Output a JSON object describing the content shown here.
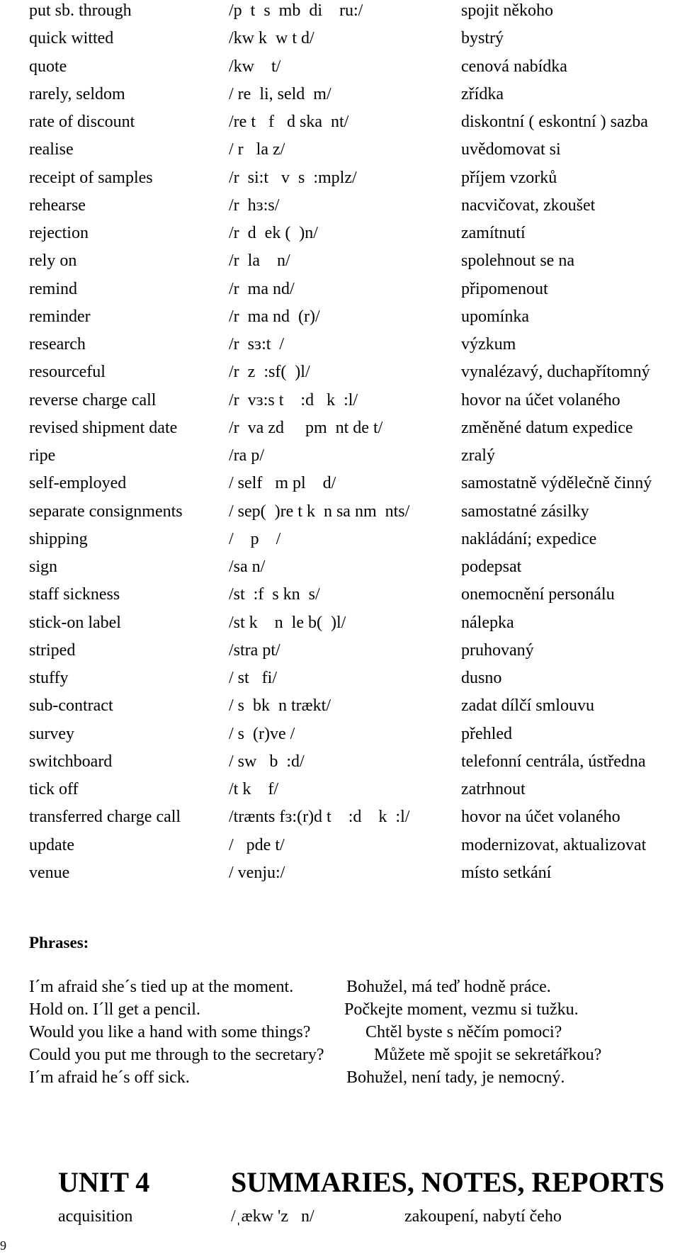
{
  "vocabulary": [
    [
      "put sb. through",
      "/p  t  s  mb  di    ru:/",
      "spojit někoho"
    ],
    [
      "quick witted",
      "/kw k  w t d/",
      "bystrý"
    ],
    [
      "quote",
      "/kw    t/",
      "cenová nabídka"
    ],
    [
      "rarely, seldom",
      "/ re  li, seld  m/",
      "zřídka"
    ],
    [
      "rate of discount",
      "/re t   f   d ska  nt/",
      "diskontní ( eskontní ) sazba"
    ],
    [
      "realise",
      "/ r   la z/",
      "uvědomovat si"
    ],
    [
      "receipt of samples",
      "/r  si:t   v  s  :mplz/",
      "příjem vzorků"
    ],
    [
      "rehearse",
      "/r  hɜ:s/",
      "nacvičovat, zkoušet"
    ],
    [
      "rejection",
      "/r  d  ek (  )n/",
      "zamítnutí"
    ],
    [
      "rely on",
      "/r  la    n/",
      "spolehnout se na"
    ],
    [
      "remind",
      "/r  ma nd/",
      "připomenout"
    ],
    [
      "reminder",
      "/r  ma nd  (r)/",
      "upomínka"
    ],
    [
      "research",
      "/r  sɜ:t  /",
      "výzkum"
    ],
    [
      "resourceful",
      "/r  z  :sf(  )l/",
      "vynalézavý, duchapřítomný"
    ],
    [
      "reverse charge call",
      "/r  vɜ:s t    :d   k  :l/",
      "hovor na účet volaného"
    ],
    [
      "revised shipment date",
      "/r  va zd     pm  nt de t/",
      "změněné datum expedice"
    ],
    [
      "ripe",
      "/ra p/",
      "zralý"
    ],
    [
      "self-employed",
      "/ self   m pl    d/",
      "samostatně výdělečně činný"
    ],
    [
      "separate consignments",
      "/ sep(  )re t k  n sa nm  nts/",
      "samostatné zásilky"
    ],
    [
      "shipping",
      "/    p    /",
      "nakládání; expedice"
    ],
    [
      "sign",
      "/sa n/",
      "podepsat"
    ],
    [
      "staff sickness",
      "/st  :f  s kn  s/",
      "onemocnění personálu"
    ],
    [
      "stick-on label",
      "/st k    n  le b(  )l/",
      "nálepka"
    ],
    [
      "striped",
      "/stra pt/",
      "pruhovaný"
    ],
    [
      "stuffy",
      "/ st   fi/",
      "dusno"
    ],
    [
      "sub-contract",
      "/ s  bk  n trækt/",
      "zadat dílčí smlouvu"
    ],
    [
      "survey",
      "/ s  (r)ve /",
      "přehled"
    ],
    [
      "switchboard",
      "/ sw   b  :d/",
      "telefonní centrála, ústředna"
    ],
    [
      "tick off",
      "/t k    f/",
      "zatrhnout"
    ],
    [
      "transferred charge call",
      "/trænts fɜ:(r)d t    :d    k  :l/",
      "hovor na účet volaného"
    ],
    [
      "update",
      "/   pde t/",
      "modernizovat, aktualizovat"
    ],
    [
      "venue",
      "/ venju:/",
      "místo setkání"
    ]
  ],
  "phrases_heading": "Phrases:",
  "phrases": [
    [
      "I´m afraid she´s tied up at the moment.",
      "Bohužel, má teď hodně práce."
    ],
    [
      "Hold on. I´ll get a pencil.",
      "Počkejte moment, vezmu si tužku."
    ],
    [
      "Would you like a hand with some things?",
      "Chtěl byste s něčím pomoci?"
    ],
    [
      "Could you put me through to the secretary?",
      "Můžete mě spojit se sekretářkou?"
    ],
    [
      "I´m afraid he´s off sick.",
      "Bohužel, není tady, je nemocný."
    ]
  ],
  "unit": {
    "number": "UNIT 4",
    "title": "SUMMARIES, NOTES, REPORTS",
    "first_entry": [
      "acquisition",
      "/ˌækw 'z   n/",
      "zakoupení, nabytí čeho"
    ]
  },
  "page_number": "9"
}
